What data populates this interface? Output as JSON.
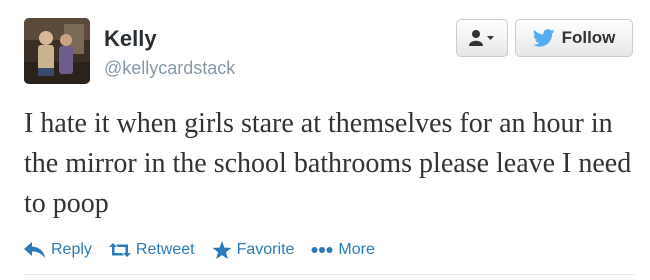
{
  "user": {
    "display_name": "Kelly",
    "handle": "@kellycardstack"
  },
  "buttons": {
    "follow_label": "Follow"
  },
  "tweet": {
    "text": "I hate it when girls stare at themselves for an hour in the mirror in the school bathrooms please leave I need to poop"
  },
  "actions": [
    {
      "icon": "reply-icon",
      "label": "Reply"
    },
    {
      "icon": "retweet-icon",
      "label": "Retweet"
    },
    {
      "icon": "star-icon",
      "label": "Favorite"
    },
    {
      "icon": "more-dots-icon",
      "label": "More"
    }
  ],
  "colors": {
    "link": "#2b7bb9",
    "twitter_bird": "#55acee",
    "handle": "#8899a6"
  }
}
